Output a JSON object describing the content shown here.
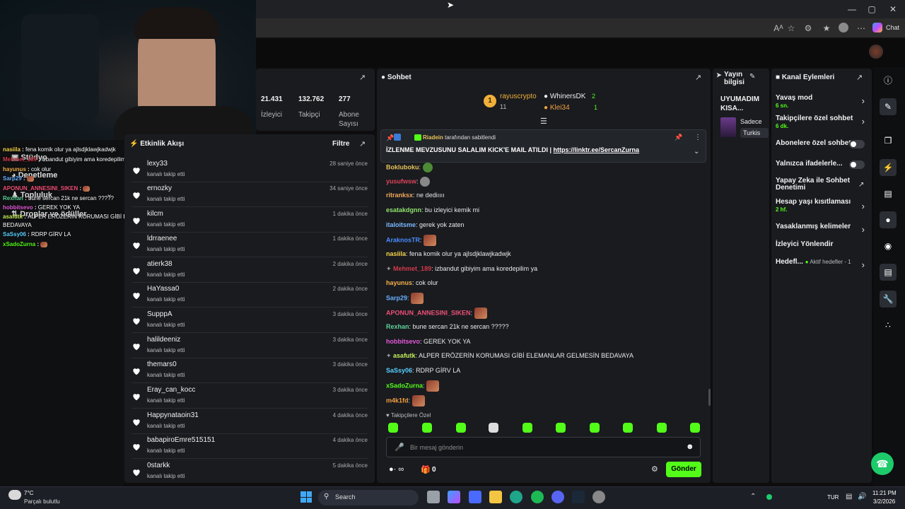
{
  "browser": {
    "read_aloud": "Aᴬ",
    "profile_label": "Chat",
    "window_controls": [
      "—",
      "▢",
      "✕"
    ]
  },
  "stats": {
    "viewers": {
      "value": "21.431",
      "label": "İzleyici"
    },
    "followers": {
      "value": "132.762",
      "label": "Takipçi"
    },
    "subscribers": {
      "value": "277",
      "label": "Abone Sayısı"
    }
  },
  "activity": {
    "title": "Etkinlik Akışı",
    "filter_label": "Filtre",
    "items": [
      {
        "name": "lexy33",
        "sub": "kanalı takip etti",
        "time": "28 saniye önce"
      },
      {
        "name": "ernozky",
        "sub": "kanalı takip etti",
        "time": "34 saniye önce"
      },
      {
        "name": "kilcm",
        "sub": "kanalı takip etti",
        "time": "1 dakika önce"
      },
      {
        "name": "ldrraenee",
        "sub": "kanalı takip etti",
        "time": "1 dakika önce"
      },
      {
        "name": "atierk38",
        "sub": "kanalı takip etti",
        "time": "2 dakika önce"
      },
      {
        "name": "HaYassa0",
        "sub": "kanalı takip etti",
        "time": "2 dakika önce"
      },
      {
        "name": "SupppA",
        "sub": "kanalı takip etti",
        "time": "3 dakika önce"
      },
      {
        "name": "halildeeniz",
        "sub": "kanalı takip etti",
        "time": "3 dakika önce"
      },
      {
        "name": "themars0",
        "sub": "kanalı takip etti",
        "time": "3 dakika önce"
      },
      {
        "name": "Eray_can_kocc",
        "sub": "kanalı takip etti",
        "time": "3 dakika önce"
      },
      {
        "name": "Happynataoin31",
        "sub": "kanalı takip etti",
        "time": "4 dakika önce"
      },
      {
        "name": "babapiroEmre515151",
        "sub": "kanalı takip etti",
        "time": "4 dakika önce"
      },
      {
        "name": "0starkk",
        "sub": "kanalı takip etti",
        "time": "5 dakika önce"
      }
    ]
  },
  "chat": {
    "title": "Sohbet",
    "leaderboard": [
      {
        "rank": "1",
        "name": "rayuscrypto",
        "count": "11"
      },
      {
        "name": "WhinersDK",
        "count": "2"
      },
      {
        "name": "Klei34",
        "count": "1"
      }
    ],
    "pinned": {
      "author": "Riadein",
      "suffix": "tarafından sabitlendi",
      "text": "İZLENME MEVZUSUNU SALALIM KICK'E MAIL ATILDI |",
      "link": "https://linktr.ee/SercanZurna"
    },
    "messages": [
      {
        "user": "Bokluboku",
        "color": "#e8c35a",
        "text": "",
        "emote": true
      },
      {
        "user": "yusufwsw",
        "color": "#e0435b",
        "text": "",
        "emote": true
      },
      {
        "user": "ritranksx",
        "color": "#f2a85a",
        "text": "ne dediıııı"
      },
      {
        "user": "esatakdgnn",
        "color": "#8fe36c",
        "text": "bu izleyici kemik mi"
      },
      {
        "user": "italoitsme",
        "color": "#7ab8ff",
        "text": "gerek yok zaten"
      },
      {
        "user": "AraknosTR",
        "color": "#4a8cff",
        "text": "",
        "emote": true
      },
      {
        "user": "nasiila",
        "color": "#f6d54a",
        "text": "fena komik olur ya ajlsdjklawjkadwjk"
      },
      {
        "user": "Mehmet_189",
        "color": "#d43a4a",
        "text": "izbandut gibiyim ama koredepilim ya"
      },
      {
        "user": "hayunus",
        "color": "#f2b04a",
        "text": "cok olur"
      },
      {
        "user": "Sarp29",
        "color": "#6ab0ff",
        "text": "",
        "emote": true
      },
      {
        "user": "APONUN_ANNESINI_SIKEN",
        "color": "#ef4f77",
        "text": "",
        "emote": true
      },
      {
        "user": "Rexhan",
        "color": "#5fd39a",
        "text": "bune sercan 21k ne sercan ?????"
      },
      {
        "user": "hobbitsevo",
        "color": "#e35ad8",
        "text": "GEREK YOK YA"
      },
      {
        "user": "asafutk",
        "color": "#c7f05a",
        "text": "ALPER ERÖZERİN KORUMASI GİBİ ELEMANLAR GELMESİN BEDAVAYA"
      },
      {
        "user": "SaSsy06",
        "color": "#5ad0ff",
        "text": "RDRP GİRV LA"
      },
      {
        "user": "xSadoZurna",
        "color": "#53fc18",
        "text": "",
        "emote": true
      },
      {
        "user": "m4k1fd",
        "color": "#f2a040",
        "text": "",
        "emote": true
      }
    ],
    "followers_only_label": "Takipçilere Özel",
    "input_placeholder": "Bir mesaj gönderin",
    "points": "∞",
    "gift_count": "0",
    "send_label": "Gönder"
  },
  "stream_info": {
    "title": "Yayın bilgisi",
    "stream_title": "UYUMADIM KISA...",
    "category": "Sadece",
    "language": "Turkis"
  },
  "channel_actions": {
    "title": "Kanal Eylemleri",
    "items": [
      {
        "label": "Yavaş mod",
        "sub": "6 sn.",
        "control": "chevron"
      },
      {
        "label": "Takipçilere özel sohbet",
        "sub": "6 dk.",
        "control": "chevron"
      },
      {
        "label": "Abonelere özel sohbet",
        "sub": "",
        "control": "toggle"
      },
      {
        "label": "Yalnızca ifadelerle...",
        "sub": "",
        "control": "toggle"
      },
      {
        "label": "Yapay Zeka ile Sohbet Denetimi",
        "sub": "",
        "control": "external"
      },
      {
        "label": "Hesap yaşı kısıtlaması",
        "sub": "2 hf.",
        "control": "chevron"
      },
      {
        "label": "Yasaklanmış kelimeler",
        "sub": "",
        "control": "chevron"
      },
      {
        "label": "İzleyici Yönlendir",
        "sub": "",
        "control": "none"
      },
      {
        "label": "Hedefl...",
        "sub": "Aktif hedefler - 1",
        "control": "chevron"
      }
    ]
  },
  "dashboard_nav": [
    {
      "label": "Stüdyo"
    },
    {
      "label": "Denetleme"
    },
    {
      "label": "Topluluk"
    },
    {
      "label": "Droplar ve ödüller"
    }
  ],
  "overlay_chat": [
    {
      "user": "nasiila",
      "text": "fena komik olur ya ajlsdjklawjkadwjk",
      "color": "#f6d54a"
    },
    {
      "user": "Mehmet_189",
      "text": "izbandut gibiyim ama koredepilim ya",
      "color": "#d43a4a"
    },
    {
      "user": "hayunus",
      "text": "cok olur",
      "color": "#f2b04a"
    },
    {
      "user": "Sarp29",
      "text": "",
      "color": "#6ab0ff"
    },
    {
      "user": "APONUN_ANNESINI_SIKEN",
      "text": "",
      "color": "#ef4f77"
    },
    {
      "user": "Rexhan",
      "text": "bune sercan 21k ne sercan ?????",
      "color": "#5fd39a"
    },
    {
      "user": "hobbitsevo",
      "text": "GEREK YOK YA",
      "color": "#e35ad8"
    },
    {
      "user": "asafutk",
      "text": "ALPER ERÖZERİN KORUMASI GİBİ ELEMANLAR GELMESİN",
      "color": "#c7f05a"
    },
    {
      "user": "",
      "text": "BEDAVAYA",
      "color": "#ffffff"
    },
    {
      "user": "SaSsy06",
      "text": "RDRP GİRV LA",
      "color": "#5ad0ff"
    },
    {
      "user": "xSadoZurna",
      "text": "",
      "color": "#53fc18"
    }
  ],
  "taskbar": {
    "weather_temp": "7°C",
    "weather_desc": "Parçalı bulutlu",
    "search_placeholder": "Search",
    "language": "TUR",
    "time": "11:21 PM",
    "date": "3/2/2026"
  },
  "colors": {
    "accent": "#53fc18",
    "panel": "#191b1f",
    "background": "#0d0d0e"
  }
}
